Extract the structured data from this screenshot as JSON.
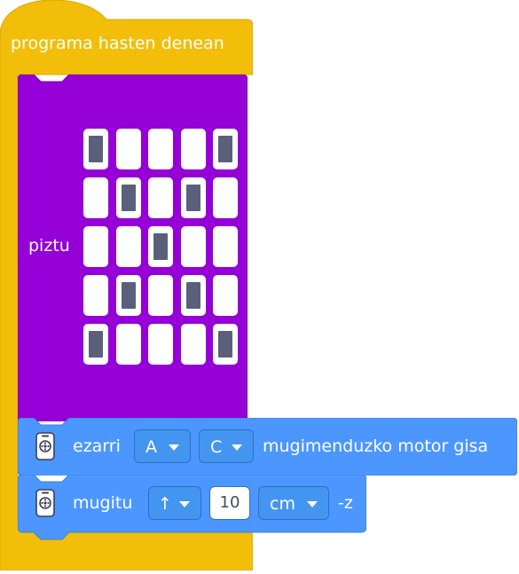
{
  "start_block": {
    "title": "programa hasten denean",
    "color": "#f2be0a"
  },
  "light_block": {
    "label": "piztu",
    "color": "#9400d6",
    "pattern": [
      [
        1,
        0,
        0,
        0,
        1
      ],
      [
        0,
        1,
        0,
        1,
        0
      ],
      [
        0,
        0,
        1,
        0,
        0
      ],
      [
        0,
        1,
        0,
        1,
        0
      ],
      [
        1,
        0,
        0,
        0,
        1
      ]
    ]
  },
  "motor_block": {
    "color": "#4c97ff",
    "icon": "motor-icon",
    "verb": "ezarri",
    "port1": "A",
    "port2": "C",
    "suffix": "mugimenduzko motor gisa"
  },
  "move_block": {
    "color": "#4c97ff",
    "icon": "motor-icon",
    "verb": "mugitu",
    "direction": "↑",
    "amount": "10",
    "unit": "cm",
    "suffix": "-z"
  }
}
